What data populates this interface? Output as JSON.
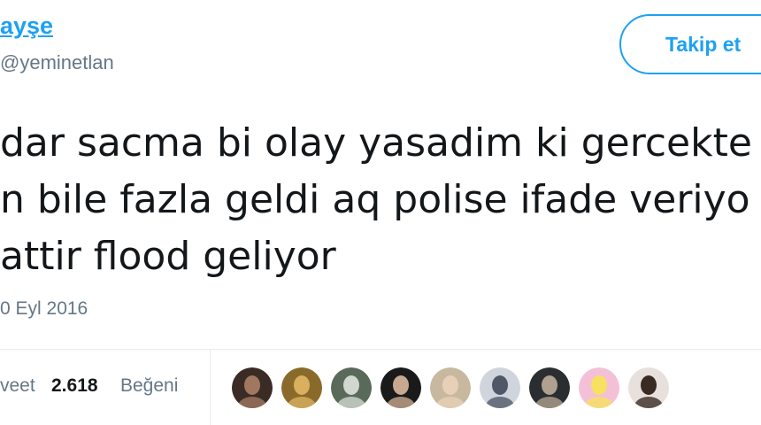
{
  "user": {
    "display_name": "ayşe",
    "handle": "@yeminetlan"
  },
  "follow_button": {
    "label": "Takip et"
  },
  "tweet": {
    "lines": [
      "dar sacma bi olay yasadim ki gercekte",
      "n bile fazla geldi aq polise ifade veriyo",
      "attir flood geliyor"
    ],
    "timestamp": "0 Eyl 2016"
  },
  "stats": {
    "retweet_label": "veet",
    "likes_count": "2.618",
    "likes_label": "Beğeni"
  },
  "likers": [
    {
      "name": "liker-avatar-1",
      "bg": "#3a2b25",
      "fg": "#a07860"
    },
    {
      "name": "liker-avatar-2",
      "bg": "#8a6a2a",
      "fg": "#d8b060"
    },
    {
      "name": "liker-avatar-3",
      "bg": "#5a6a5a",
      "fg": "#d0d8d0"
    },
    {
      "name": "liker-avatar-4",
      "bg": "#1a1a1a",
      "fg": "#c8a890"
    },
    {
      "name": "liker-avatar-5",
      "bg": "#c8b8a0",
      "fg": "#e8d0b8"
    },
    {
      "name": "liker-avatar-6",
      "bg": "#d0d4dc",
      "fg": "#505868"
    },
    {
      "name": "liker-avatar-7",
      "bg": "#2a2e30",
      "fg": "#b0a090"
    },
    {
      "name": "liker-avatar-8",
      "bg": "#f4c0d8",
      "fg": "#f8e060"
    },
    {
      "name": "liker-avatar-9",
      "bg": "#e8e0dc",
      "fg": "#3a2a24"
    }
  ],
  "colors": {
    "accent": "#1da1f2",
    "text_primary": "#14171a",
    "text_secondary": "#657786",
    "divider": "#e6ecf0"
  }
}
